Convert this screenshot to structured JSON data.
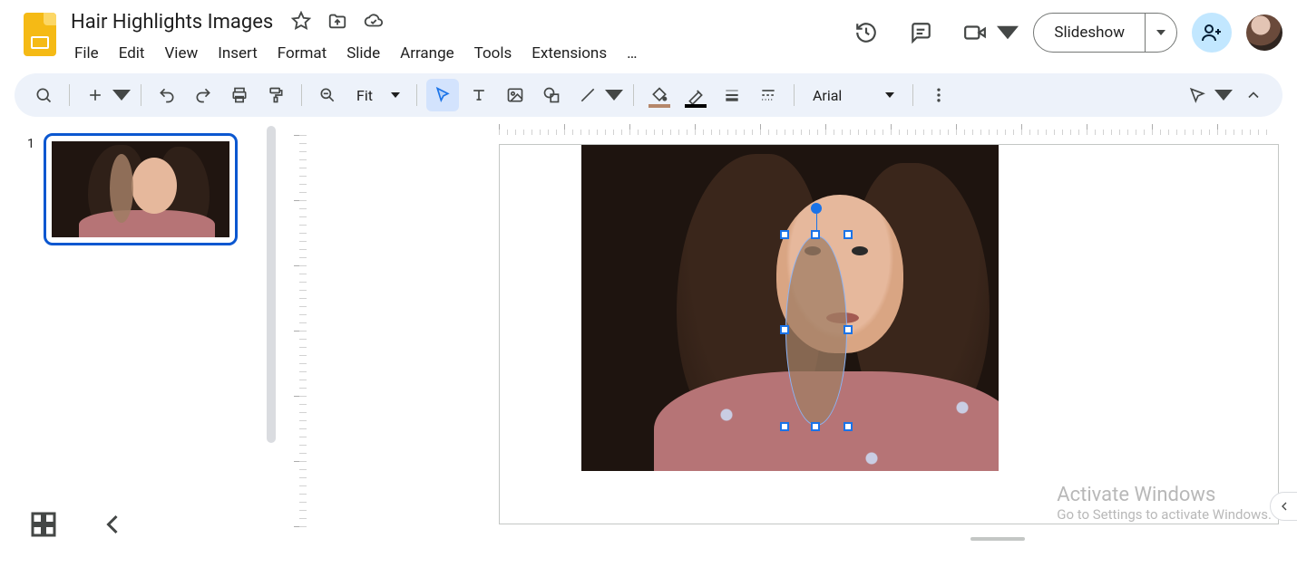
{
  "doc": {
    "title": "Hair Highlights Images"
  },
  "menu": {
    "file": "File",
    "edit": "Edit",
    "view": "View",
    "insert": "Insert",
    "format": "Format",
    "slide": "Slide",
    "arrange": "Arrange",
    "tools": "Tools",
    "extensions": "Extensions",
    "more": "…"
  },
  "header_buttons": {
    "slideshow": "Slideshow"
  },
  "toolbar": {
    "zoom_mode": "Fit",
    "font_family": "Arial"
  },
  "filmstrip": {
    "slides": [
      {
        "number": "1"
      }
    ]
  },
  "watermark": {
    "line1": "Activate Windows",
    "line2": "Go to Settings to activate Windows."
  }
}
